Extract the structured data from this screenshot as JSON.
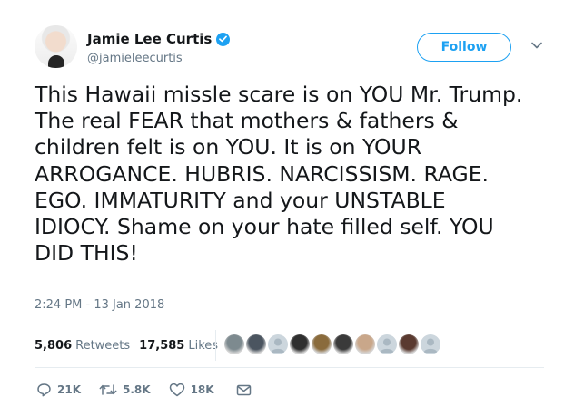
{
  "tweet": {
    "author": {
      "name": "Jamie Lee Curtis",
      "handle": "@jamieleecurtis",
      "verified": true
    },
    "follow_label": "Follow",
    "text": "This Hawaii missle scare is on YOU Mr. Trump.\nThe real FEAR that mothers & fathers &\nchildren felt is on YOU. It is on YOUR\nARROGANCE. HUBRIS. NARCISSISM. RAGE.\nEGO. IMMATURITY and your UNSTABLE\nIDIOCY. Shame on your hate filled self. YOU\nDID THIS!",
    "timestamp": "2:24 PM - 13 Jan 2018"
  },
  "stats": {
    "retweets_count": "5,806",
    "retweets_label": "Retweets",
    "likes_count": "17,585",
    "likes_label": "Likes"
  },
  "likers": [
    {
      "icon": "liker-avatar-photo",
      "color": "#7d8a8f"
    },
    {
      "icon": "liker-avatar-photo",
      "color": "#4b5560"
    },
    {
      "icon": "default-avatar-icon",
      "color": "#aab8c2"
    },
    {
      "icon": "liker-avatar-photo",
      "color": "#2f2f2f"
    },
    {
      "icon": "liker-avatar-photo",
      "color": "#8a6b3c"
    },
    {
      "icon": "liker-avatar-photo",
      "color": "#3a3a3a"
    },
    {
      "icon": "liker-avatar-photo",
      "color": "#c9a78a"
    },
    {
      "icon": "default-avatar-icon",
      "color": "#aab8c2"
    },
    {
      "icon": "liker-avatar-photo",
      "color": "#5a3a30"
    },
    {
      "icon": "default-avatar-icon",
      "color": "#aab8c2"
    }
  ],
  "actions": {
    "replies": "21K",
    "retweets": "5.8K",
    "likes": "18K"
  },
  "colors": {
    "accent": "#1da1f2",
    "text": "#14171a",
    "secondary": "#657786",
    "border": "#e6ecf0"
  }
}
